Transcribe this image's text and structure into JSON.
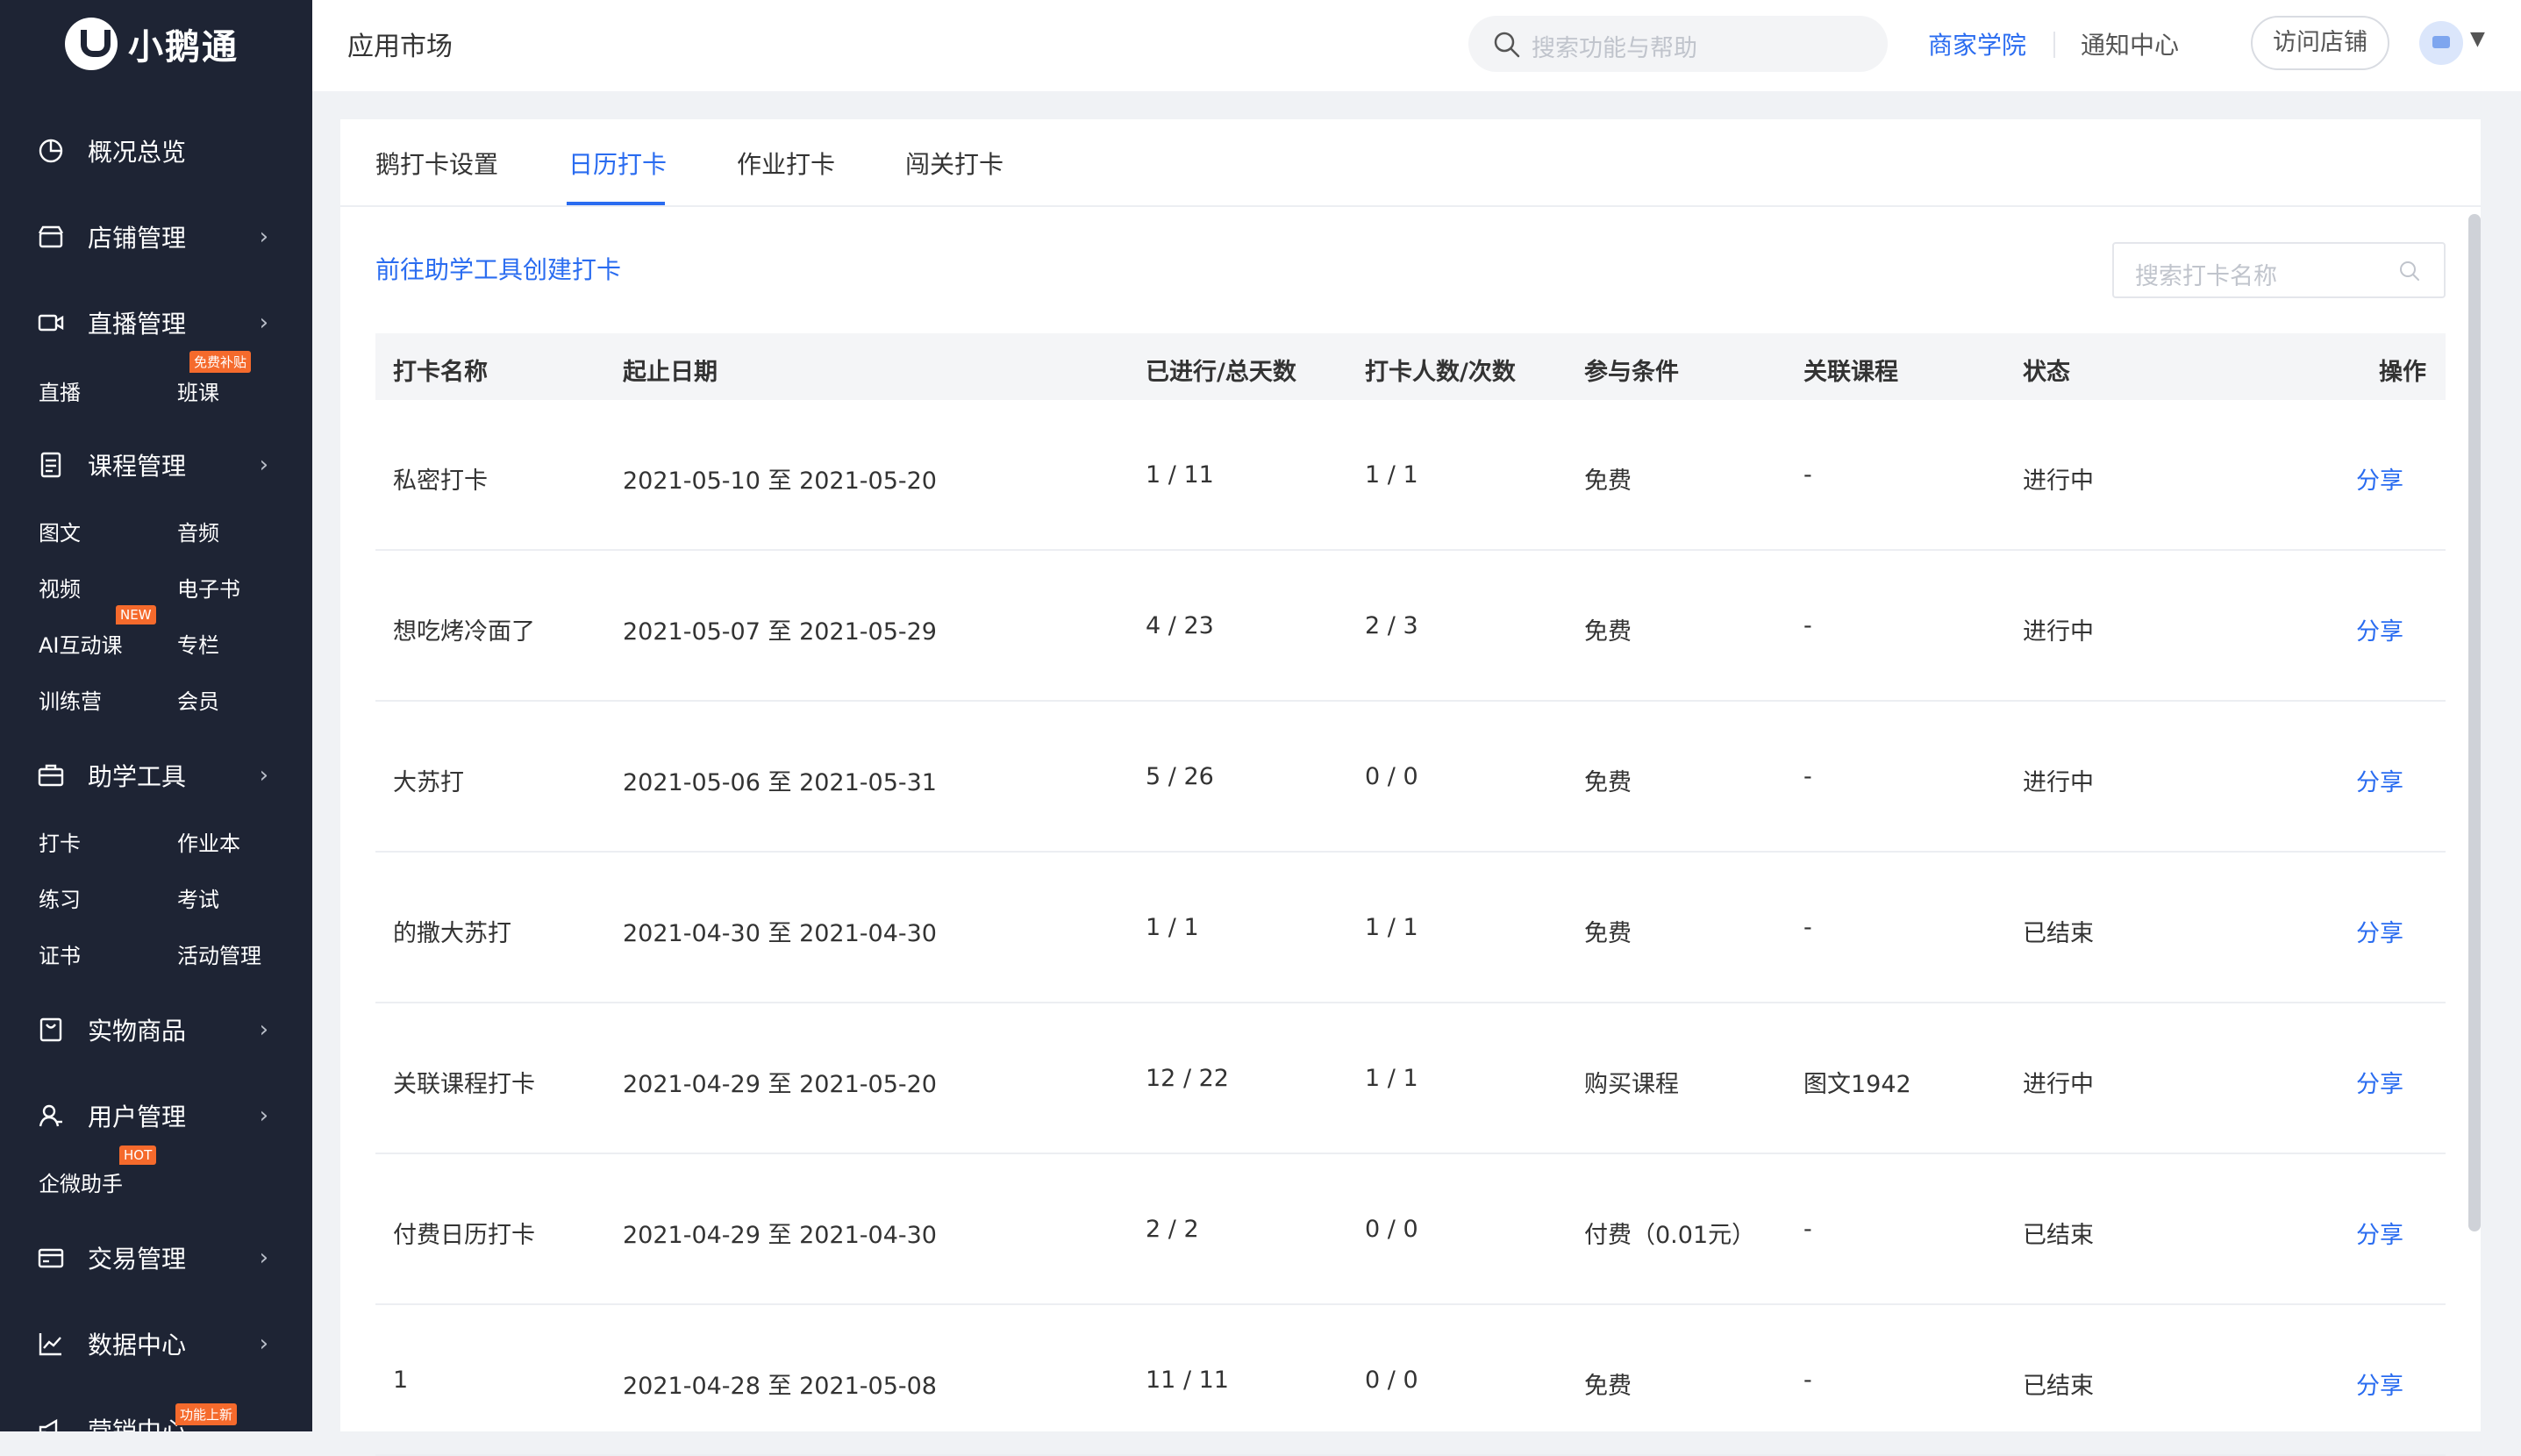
{
  "brand": {
    "name": "小鹅通"
  },
  "sidebar": {
    "groups": [
      {
        "label": "概况总览",
        "icon": "pie-chart-icon",
        "has_arrow": false,
        "items": []
      },
      {
        "label": "店铺管理",
        "icon": "store-icon",
        "has_arrow": true,
        "items": []
      },
      {
        "label": "直播管理",
        "icon": "video-camera-icon",
        "has_arrow": true,
        "items": [
          {
            "label": "直播",
            "badge": ""
          },
          {
            "label": "班课",
            "badge": "免费补贴"
          }
        ]
      },
      {
        "label": "课程管理",
        "icon": "document-icon",
        "has_arrow": true,
        "items": [
          {
            "label": "图文",
            "badge": ""
          },
          {
            "label": "音频",
            "badge": ""
          },
          {
            "label": "视频",
            "badge": ""
          },
          {
            "label": "电子书",
            "badge": ""
          },
          {
            "label": "AI互动课",
            "badge": "NEW"
          },
          {
            "label": "专栏",
            "badge": ""
          },
          {
            "label": "训练营",
            "badge": ""
          },
          {
            "label": "会员",
            "badge": ""
          }
        ]
      },
      {
        "label": "助学工具",
        "icon": "briefcase-icon",
        "has_arrow": true,
        "items": [
          {
            "label": "打卡",
            "badge": ""
          },
          {
            "label": "作业本",
            "badge": ""
          },
          {
            "label": "练习",
            "badge": ""
          },
          {
            "label": "考试",
            "badge": ""
          },
          {
            "label": "证书",
            "badge": ""
          },
          {
            "label": "活动管理",
            "badge": ""
          }
        ]
      },
      {
        "label": "实物商品",
        "icon": "shopping-bag-icon",
        "has_arrow": true,
        "items": []
      },
      {
        "label": "用户管理",
        "icon": "user-icon",
        "has_arrow": true,
        "items": [
          {
            "label": "企微助手",
            "badge": "HOT"
          }
        ]
      },
      {
        "label": "交易管理",
        "icon": "credit-card-icon",
        "has_arrow": true,
        "items": []
      },
      {
        "label": "数据中心",
        "icon": "line-chart-icon",
        "has_arrow": true,
        "items": []
      },
      {
        "label": "营销中心",
        "icon": "megaphone-icon",
        "has_arrow": false,
        "badge": "功能上新",
        "items": []
      }
    ]
  },
  "topbar": {
    "title": "应用市场",
    "search_placeholder": "搜索功能与帮助",
    "school_link": "商家学院",
    "notice": "通知中心",
    "visit_store": "访问店铺"
  },
  "tabs": [
    {
      "label": "鹅打卡设置",
      "active": false
    },
    {
      "label": "日历打卡",
      "active": true
    },
    {
      "label": "作业打卡",
      "active": false
    },
    {
      "label": "闯关打卡",
      "active": false
    }
  ],
  "create_link": "前往助学工具创建打卡",
  "card_search_placeholder": "搜索打卡名称",
  "table": {
    "headers": [
      "打卡名称",
      "起止日期",
      "已进行/总天数",
      "打卡人数/次数",
      "参与条件",
      "关联课程",
      "状态",
      "操作"
    ],
    "rows": [
      [
        "私密打卡",
        "2021-05-10 至 2021-05-20",
        "1 / 11",
        "1 / 1",
        "免费",
        "-",
        "进行中",
        "分享"
      ],
      [
        "想吃烤冷面了",
        "2021-05-07 至 2021-05-29",
        "4 / 23",
        "2 / 3",
        "免费",
        "-",
        "进行中",
        "分享"
      ],
      [
        "大苏打",
        "2021-05-06 至 2021-05-31",
        "5 / 26",
        "0 / 0",
        "免费",
        "-",
        "进行中",
        "分享"
      ],
      [
        "的撒大苏打",
        "2021-04-30 至 2021-04-30",
        "1 / 1",
        "1 / 1",
        "免费",
        "-",
        "已结束",
        "分享"
      ],
      [
        "关联课程打卡",
        "2021-04-29 至 2021-05-20",
        "12 / 22",
        "1 / 1",
        "购买课程",
        "图文1942",
        "进行中",
        "分享"
      ],
      [
        "付费日历打卡",
        "2021-04-29 至 2021-04-30",
        "2 / 2",
        "0 / 0",
        "付费（0.01元）",
        "-",
        "已结束",
        "分享"
      ],
      [
        "1",
        "2021-04-28 至 2021-05-08",
        "11 / 11",
        "0 / 0",
        "免费",
        "-",
        "已结束",
        "分享"
      ]
    ]
  }
}
